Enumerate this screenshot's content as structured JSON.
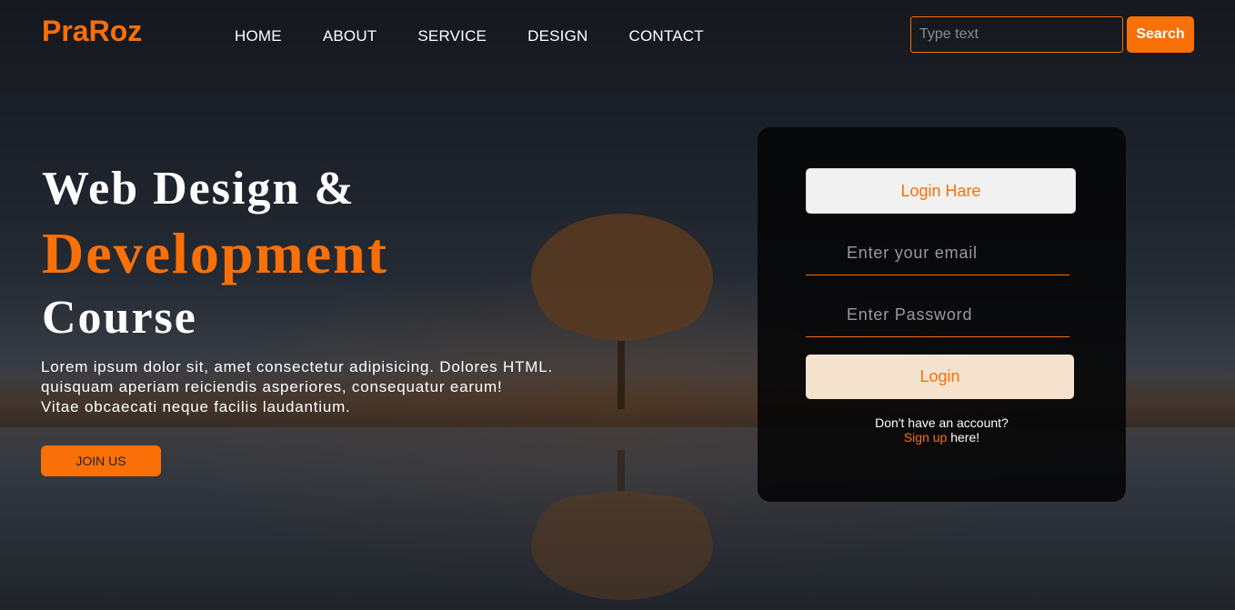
{
  "brand": {
    "logo": "PraRoz",
    "accent_color": "#f97008"
  },
  "nav": {
    "items": [
      {
        "label": "HOME"
      },
      {
        "label": "ABOUT"
      },
      {
        "label": "SERVICE"
      },
      {
        "label": "DESIGN"
      },
      {
        "label": "CONTACT"
      }
    ]
  },
  "search": {
    "placeholder": "Type text",
    "button_label": "Search"
  },
  "hero": {
    "title_line1": "Web Design &",
    "title_line2": "Development",
    "title_line3": "Course",
    "description": [
      "Lorem ipsum dolor sit, amet consectetur adipisicing. Dolores HTML.",
      "quisquam aperiam reiciendis asperiores, consequatur earum!",
      "Vitae obcaecati neque facilis laudantium."
    ],
    "join_label": "JOIN US"
  },
  "login": {
    "header": "Login Hare",
    "email_placeholder": "Enter your email",
    "password_placeholder": "Enter Password",
    "button_label": "Login",
    "signup_prompt": "Don't have an account?",
    "signup_link": "Sign up",
    "signup_suffix": " here!"
  }
}
